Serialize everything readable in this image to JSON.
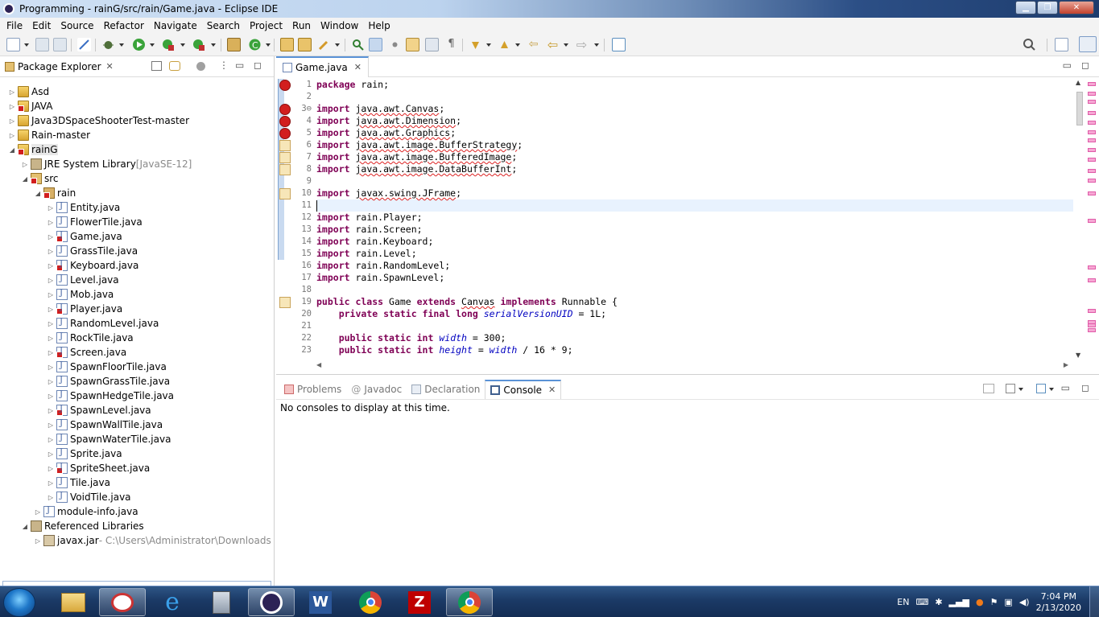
{
  "window": {
    "title": "Programming - rainG/src/rain/Game.java - Eclipse IDE",
    "minimize_icon": "minimize-icon",
    "maximize_icon": "maximize-icon",
    "close_icon": "close-icon"
  },
  "menubar": {
    "items": [
      "File",
      "Edit",
      "Source",
      "Refactor",
      "Navigate",
      "Search",
      "Project",
      "Run",
      "Window",
      "Help"
    ]
  },
  "toolbar": {
    "icons": [
      "new-icon",
      "save-icon",
      "save-all-icon",
      "skip-breakpoints-icon",
      "debug-icon",
      "run-icon",
      "coverage-icon",
      "external-tools-icon",
      "new-java-project-icon",
      "new-package-icon",
      "open-type-icon",
      "search-icon",
      "toggle-mark-occurrences-icon",
      "next-annotation-icon",
      "previous-annotation-icon",
      "back-icon",
      "forward-icon",
      "pin-editor-icon"
    ],
    "search_icon": "search-icon",
    "perspective_icon": "java-perspective-icon"
  },
  "package_explorer": {
    "tab_label": "Package Explorer",
    "tab_close": "✕",
    "tree": [
      {
        "label": "Asd",
        "hint": "",
        "level": 0,
        "icon": "project-icon",
        "arrow": "▷",
        "error": false
      },
      {
        "label": "JAVA",
        "hint": "",
        "level": 0,
        "icon": "project-icon",
        "arrow": "▷",
        "error": true
      },
      {
        "label": "Java3DSpaceShooterTest-master",
        "hint": "",
        "level": 0,
        "icon": "project-icon",
        "arrow": "▷",
        "error": false
      },
      {
        "label": "Rain-master",
        "hint": "",
        "level": 0,
        "icon": "project-icon",
        "arrow": "▷",
        "error": false
      },
      {
        "label": "rainG",
        "hint": "",
        "level": 0,
        "icon": "project-icon",
        "arrow": "◢",
        "error": true,
        "selected": true
      },
      {
        "label": "JRE System Library",
        "hint": " [JavaSE-12]",
        "level": 1,
        "icon": "library-icon",
        "arrow": "▷",
        "error": false
      },
      {
        "label": "src",
        "hint": "",
        "level": 1,
        "icon": "source-folder-icon",
        "arrow": "◢",
        "error": true
      },
      {
        "label": "rain",
        "hint": "",
        "level": 2,
        "icon": "package-icon",
        "arrow": "◢",
        "error": true
      },
      {
        "label": "Entity.java",
        "hint": "",
        "level": 3,
        "icon": "java-file-icon",
        "arrow": "▷",
        "error": false
      },
      {
        "label": "FlowerTile.java",
        "hint": "",
        "level": 3,
        "icon": "java-file-icon",
        "arrow": "▷",
        "error": false
      },
      {
        "label": "Game.java",
        "hint": "",
        "level": 3,
        "icon": "java-file-icon",
        "arrow": "▷",
        "error": true
      },
      {
        "label": "GrassTile.java",
        "hint": "",
        "level": 3,
        "icon": "java-file-icon",
        "arrow": "▷",
        "error": false
      },
      {
        "label": "Keyboard.java",
        "hint": "",
        "level": 3,
        "icon": "java-file-icon",
        "arrow": "▷",
        "error": true
      },
      {
        "label": "Level.java",
        "hint": "",
        "level": 3,
        "icon": "java-file-icon",
        "arrow": "▷",
        "error": false
      },
      {
        "label": "Mob.java",
        "hint": "",
        "level": 3,
        "icon": "java-file-icon",
        "arrow": "▷",
        "error": false
      },
      {
        "label": "Player.java",
        "hint": "",
        "level": 3,
        "icon": "java-file-icon",
        "arrow": "▷",
        "error": true
      },
      {
        "label": "RandomLevel.java",
        "hint": "",
        "level": 3,
        "icon": "java-file-icon",
        "arrow": "▷",
        "error": false
      },
      {
        "label": "RockTile.java",
        "hint": "",
        "level": 3,
        "icon": "java-file-icon",
        "arrow": "▷",
        "error": false
      },
      {
        "label": "Screen.java",
        "hint": "",
        "level": 3,
        "icon": "java-file-icon",
        "arrow": "▷",
        "error": true
      },
      {
        "label": "SpawnFloorTile.java",
        "hint": "",
        "level": 3,
        "icon": "java-file-icon",
        "arrow": "▷",
        "error": false
      },
      {
        "label": "SpawnGrassTile.java",
        "hint": "",
        "level": 3,
        "icon": "java-file-icon",
        "arrow": "▷",
        "error": false
      },
      {
        "label": "SpawnHedgeTile.java",
        "hint": "",
        "level": 3,
        "icon": "java-file-icon",
        "arrow": "▷",
        "error": false
      },
      {
        "label": "SpawnLevel.java",
        "hint": "",
        "level": 3,
        "icon": "java-file-icon",
        "arrow": "▷",
        "error": true
      },
      {
        "label": "SpawnWallTile.java",
        "hint": "",
        "level": 3,
        "icon": "java-file-icon",
        "arrow": "▷",
        "error": false
      },
      {
        "label": "SpawnWaterTile.java",
        "hint": "",
        "level": 3,
        "icon": "java-file-icon",
        "arrow": "▷",
        "error": false
      },
      {
        "label": "Sprite.java",
        "hint": "",
        "level": 3,
        "icon": "java-file-icon",
        "arrow": "▷",
        "error": false
      },
      {
        "label": "SpriteSheet.java",
        "hint": "",
        "level": 3,
        "icon": "java-file-icon",
        "arrow": "▷",
        "error": true
      },
      {
        "label": "Tile.java",
        "hint": "",
        "level": 3,
        "icon": "java-file-icon",
        "arrow": "▷",
        "error": false
      },
      {
        "label": "VoidTile.java",
        "hint": "",
        "level": 3,
        "icon": "java-file-icon",
        "arrow": "▷",
        "error": false
      },
      {
        "label": "module-info.java",
        "hint": "",
        "level": 2,
        "icon": "java-file-icon",
        "arrow": "▷",
        "error": false
      },
      {
        "label": "Referenced Libraries",
        "hint": "",
        "level": 1,
        "icon": "library-icon",
        "arrow": "◢",
        "error": false
      },
      {
        "label": "javax.jar",
        "hint": " - C:\\Users\\Administrator\\Downloads",
        "level": 2,
        "icon": "jar-icon",
        "arrow": "▷",
        "error": false
      }
    ]
  },
  "editor": {
    "tab_label": "Game.java",
    "tab_close": "✕",
    "lines": [
      {
        "n": "1",
        "marker": "error",
        "html": "<span class=\"kw\">package</span> rain;"
      },
      {
        "n": "2",
        "marker": "",
        "html": ""
      },
      {
        "n": "3⊖",
        "marker": "error",
        "html": "<span class=\"kw\">import</span> <span class=\"sq\">java.awt.Canvas</span>;"
      },
      {
        "n": "4",
        "marker": "error",
        "html": "<span class=\"kw\">import</span> <span class=\"sq\">java.awt.Dimension</span>;"
      },
      {
        "n": "5",
        "marker": "error",
        "html": "<span class=\"kw\">import</span> <span class=\"sq\">java.awt.Graphics</span>;"
      },
      {
        "n": "6",
        "marker": "warn",
        "html": "<span class=\"kw\">import</span> <span class=\"sq\">java.awt.image.BufferStrategy</span>;"
      },
      {
        "n": "7",
        "marker": "warn",
        "html": "<span class=\"kw\">import</span> <span class=\"sq\">java.awt.image.BufferedImage</span>;"
      },
      {
        "n": "8",
        "marker": "warn",
        "html": "<span class=\"kw\">import</span> <span class=\"sq\">java.awt.image.DataBufferInt</span>;"
      },
      {
        "n": "9",
        "marker": "",
        "html": ""
      },
      {
        "n": "10",
        "marker": "warn",
        "html": "<span class=\"kw\">import</span> <span class=\"sq\">javax.swing.JFrame</span>;"
      },
      {
        "n": "11",
        "marker": "",
        "html": "",
        "current": true
      },
      {
        "n": "12",
        "marker": "",
        "html": "<span class=\"kw\">import</span> rain.Player;"
      },
      {
        "n": "13",
        "marker": "",
        "html": "<span class=\"kw\">import</span> rain.Screen;"
      },
      {
        "n": "14",
        "marker": "",
        "html": "<span class=\"kw\">import</span> rain.Keyboard;"
      },
      {
        "n": "15",
        "marker": "",
        "html": "<span class=\"kw\">import</span> rain.Level;"
      },
      {
        "n": "16",
        "marker": "",
        "html": "<span class=\"kw\">import</span> rain.RandomLevel;"
      },
      {
        "n": "17",
        "marker": "",
        "html": "<span class=\"kw\">import</span> rain.SpawnLevel;"
      },
      {
        "n": "18",
        "marker": "",
        "html": ""
      },
      {
        "n": "19",
        "marker": "warn",
        "html": "<span class=\"kw\">public class</span> Game <span class=\"kw\">extends</span> <span class=\"sq\">Canvas</span> <span class=\"kw\">implements</span> Runnable {"
      },
      {
        "n": "20",
        "marker": "",
        "html": "    <span class=\"kw\">private static final long</span> <span class=\"fld\">serialVersionUID</span> = 1L;"
      },
      {
        "n": "21",
        "marker": "",
        "html": ""
      },
      {
        "n": "22",
        "marker": "",
        "html": "    <span class=\"kw\">public static int</span> <span class=\"fld\">width</span> = 300;"
      },
      {
        "n": "23",
        "marker": "",
        "html": "    <span class=\"kw\">public static int</span> <span class=\"fld\">height</span> = <span class=\"fld\">width</span> / 16 * 9;"
      }
    ]
  },
  "bottom_panel": {
    "tabs": [
      {
        "label": "Problems",
        "active": false,
        "icon": "problems-icon"
      },
      {
        "label": "Javadoc",
        "active": false,
        "icon": "javadoc-icon"
      },
      {
        "label": "Declaration",
        "active": false,
        "icon": "declaration-icon"
      },
      {
        "label": "Console",
        "active": true,
        "icon": "console-icon"
      }
    ],
    "tab_close": "✕",
    "javadoc_prefix": "@",
    "message": "No consoles to display at this time."
  },
  "taskbar": {
    "language": "EN",
    "time": "7:04 PM",
    "date": "2/13/2020",
    "apps": [
      "explorer-icon",
      "snipping-tool-icon",
      "internet-explorer-icon",
      "calculator-icon",
      "eclipse-icon",
      "word-icon",
      "chrome-icon",
      "filezilla-icon",
      "chrome-user-icon"
    ]
  },
  "colors": {
    "accent": "#5a92d6",
    "error": "#d21e1e",
    "keyword": "#7f0055",
    "field": "#0000c0"
  }
}
